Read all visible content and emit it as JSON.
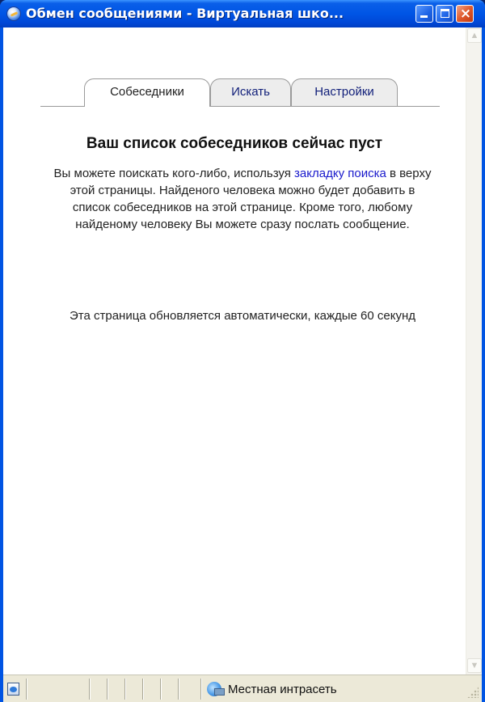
{
  "window": {
    "title": "Обмен сообщениями - Виртуальная шко...",
    "controls": {
      "minimize": "minimize",
      "maximize": "maximize",
      "close": "×"
    }
  },
  "tabs": [
    {
      "label": "Собеседники",
      "active": true
    },
    {
      "label": "Искать",
      "active": false
    },
    {
      "label": "Настройки",
      "active": false
    }
  ],
  "main": {
    "heading": "Ваш список собеседников сейчас пуст",
    "para_before_link": "Вы можете поискать кого-либо, используя ",
    "link_text": "закладку поиска",
    "para_after_link": " в верху этой страницы. Найденого человека можно будет добавить в список собеседников на этой странице. Кроме того, любому найденому человеку Вы можете сразу послать сообщение.",
    "refresh_note": "Эта страница обновляется автоматически, каждые 60 секунд"
  },
  "statusbar": {
    "zone_text": "Местная интрасеть"
  },
  "colors": {
    "titlebar": "#0055e5",
    "link": "#1a1acc",
    "tab_text": "#12207a",
    "statusbar_bg": "#ece9d8"
  },
  "icons": {
    "app": "ie-globe-icon",
    "page": "page-icon",
    "zone": "intranet-zone-icon"
  }
}
